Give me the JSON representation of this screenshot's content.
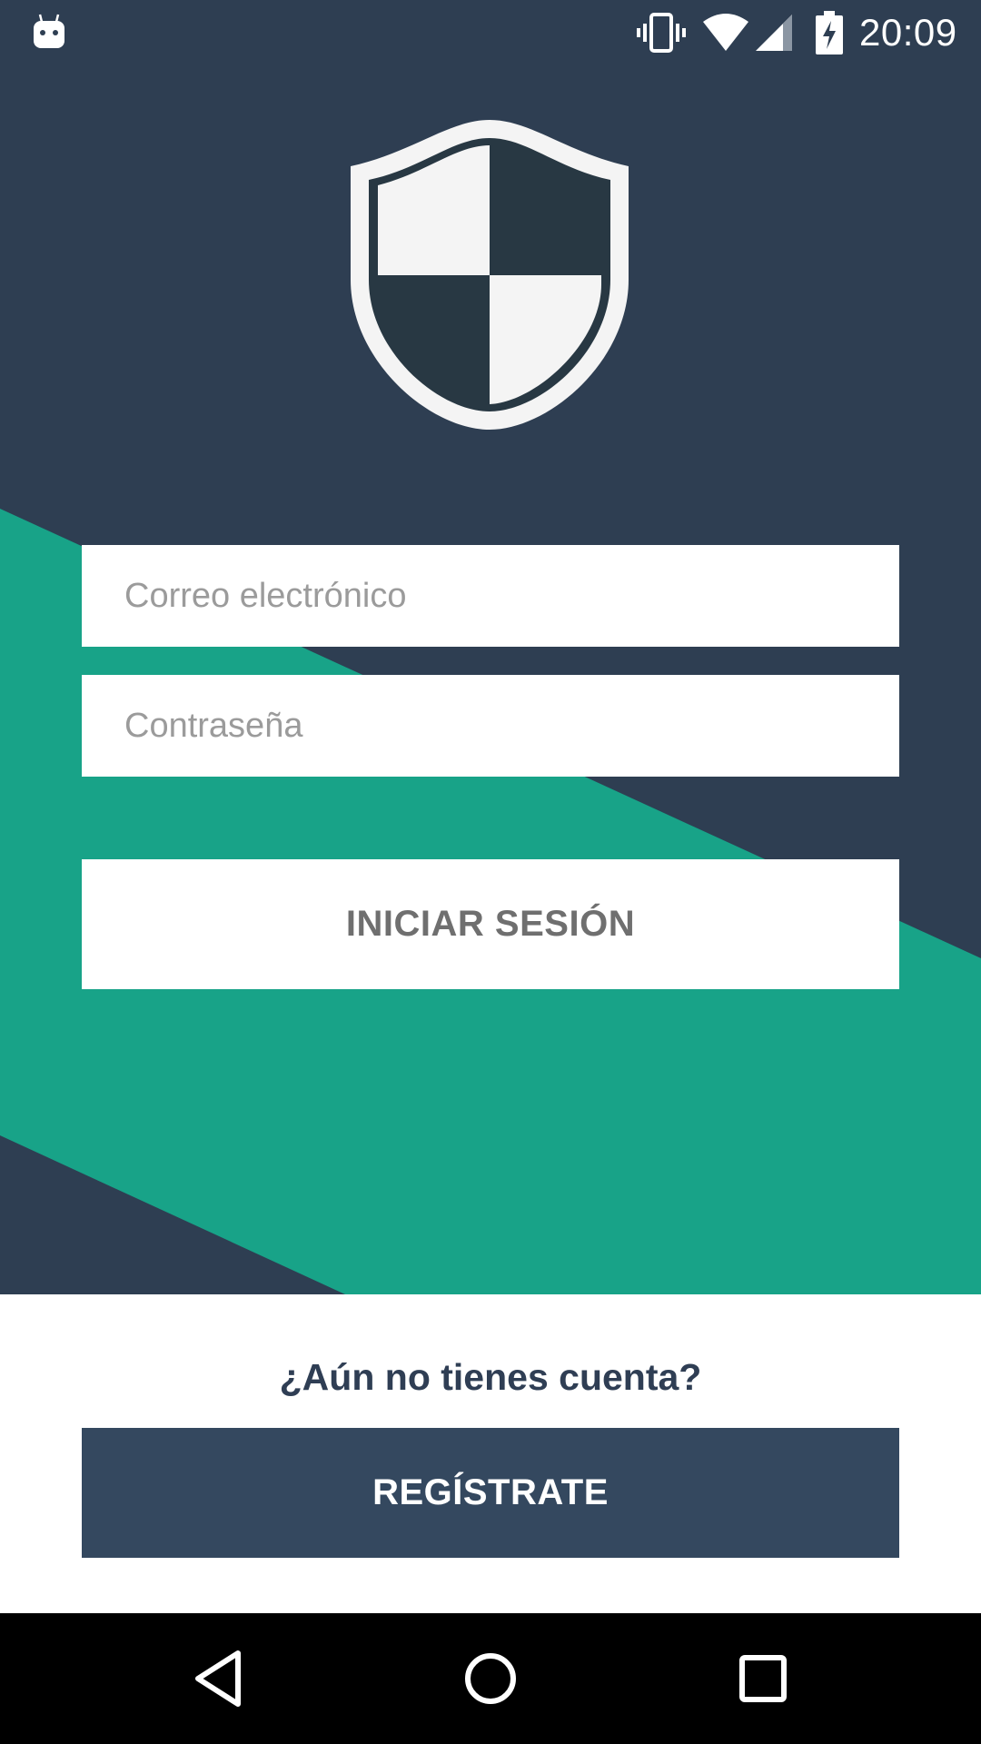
{
  "status_bar": {
    "time": "20:09",
    "icons": [
      "android-notification-icon",
      "vibrate-icon",
      "wifi-icon",
      "signal-icon",
      "battery-charging-icon"
    ]
  },
  "logo": {
    "icon": "shield-icon"
  },
  "login_form": {
    "email_placeholder": "Correo electrónico",
    "email_value": "",
    "password_placeholder": "Contraseña",
    "password_value": "",
    "login_label": "INICIAR SESIÓN"
  },
  "register_section": {
    "prompt": "¿Aún no tienes cuenta?",
    "register_label": "REGÍSTRATE"
  },
  "nav_bar": {
    "icons": [
      "back-icon",
      "home-icon",
      "recents-icon"
    ]
  },
  "colors": {
    "background_dark": "#2e3e52",
    "accent_teal": "#18a388",
    "register_button": "#34485f",
    "white": "#ffffff"
  }
}
